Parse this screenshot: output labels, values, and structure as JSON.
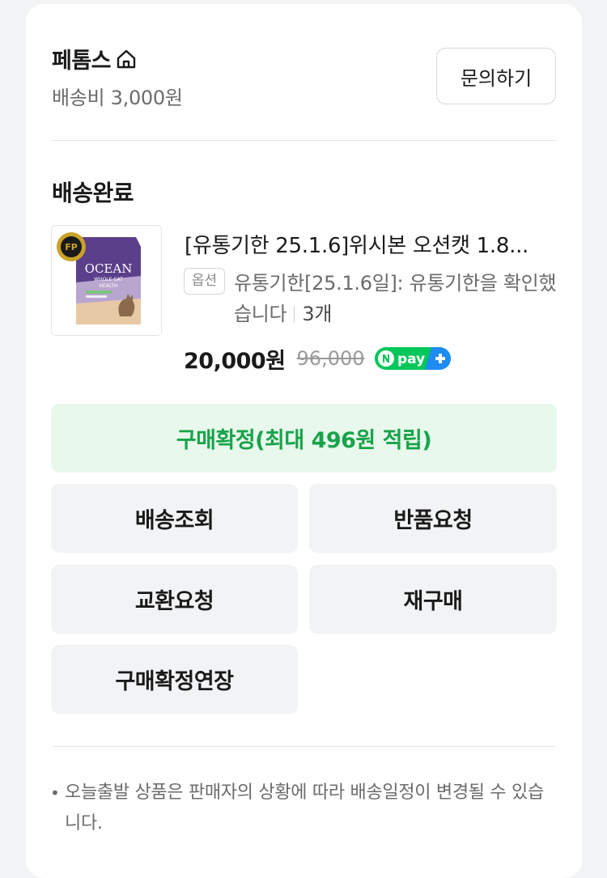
{
  "seller": {
    "name": "페톰스",
    "shipping_fee": "배송비 3,000원",
    "inquiry_label": "문의하기"
  },
  "order": {
    "status": "배송완료",
    "product_title": "[유통기한 25.1.6]위시본 오션캣 1.8...",
    "option_badge": "옵션",
    "option_text": "유통기한[25.1.6일]: 유통기한을 확인했습니다",
    "quantity": "3개",
    "price": "20,000원",
    "original_price": "96,000",
    "pay_badge": "pay"
  },
  "package": {
    "brand": "OCEAN",
    "line1": "WHOLE CAT",
    "line2": "HEALTH",
    "seal": "FP"
  },
  "buttons": {
    "confirm": "구매확정(최대 496원 적립)",
    "track": "배송조회",
    "return": "반품요청",
    "exchange": "교환요청",
    "rebuy": "재구매",
    "extend": "구매확정연장"
  },
  "notice": {
    "bullet": "•",
    "text": "오늘출발 상품은 판매자의 상황에 따라 배송일정이 변경될 수 있습니다."
  },
  "colors": {
    "confirm_bg": "#e8f8ec",
    "confirm_text": "#18a34a",
    "npay_green": "#03c75a",
    "npay_blue": "#1e8cf0"
  }
}
